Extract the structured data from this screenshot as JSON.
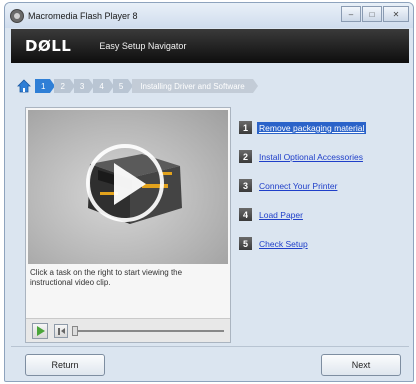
{
  "window": {
    "title": "Macromedia Flash Player 8",
    "buttons": [
      "–",
      "□",
      "✕"
    ]
  },
  "header": {
    "logo": "DØLL",
    "title": "Easy Setup Navigator"
  },
  "nav": {
    "steps": [
      "1",
      "2",
      "3",
      "4",
      "5"
    ],
    "active_step": "1",
    "trailing_label": "Installing Driver and Software"
  },
  "video": {
    "caption": "Click a task on the right to start viewing the instructional video clip.",
    "progress": 0.0
  },
  "tasks": [
    {
      "num": "1",
      "label": "Remove packaging material",
      "selected": true
    },
    {
      "num": "2",
      "label": "Install Optional Accessories",
      "selected": false
    },
    {
      "num": "3",
      "label": "Connect Your Printer",
      "selected": false
    },
    {
      "num": "4",
      "label": "Load Paper",
      "selected": false
    },
    {
      "num": "5",
      "label": "Check Setup",
      "selected": false
    }
  ],
  "footer": {
    "return_label": "Return",
    "next_label": "Next"
  },
  "colors": {
    "accent": "#2f7fd6",
    "link": "#1f3fc9",
    "selected_bg": "#2b63c9",
    "header_bg": "#0e0e0e"
  }
}
